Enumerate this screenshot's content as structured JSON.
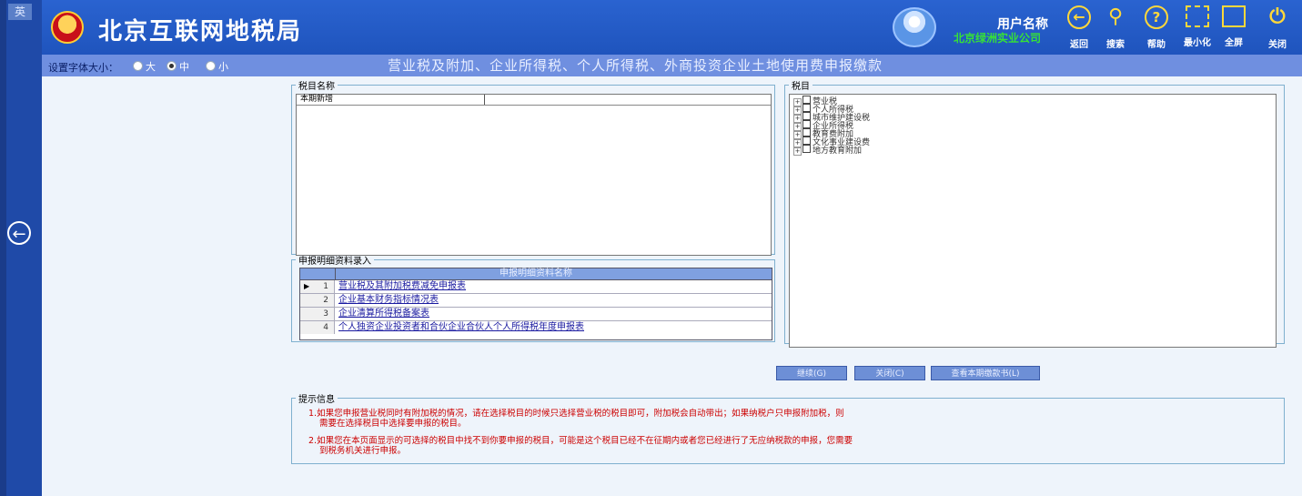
{
  "sidebar": {
    "ying_label": "英"
  },
  "header": {
    "site_title": "北京互联网地税局",
    "user_label": "用户名称",
    "user_company": "北京绿洲实业公司",
    "tools": [
      {
        "label": "返回",
        "icon": "back-circle-icon",
        "glyph": "⊖"
      },
      {
        "label": "搜索",
        "icon": "search-icon",
        "glyph": "Q"
      },
      {
        "label": "帮助",
        "icon": "help-icon",
        "glyph": "?"
      },
      {
        "label": "最小化",
        "icon": "minimize-icon",
        "glyph": "⊏"
      },
      {
        "label": "全屏",
        "icon": "fullscreen-icon",
        "glyph": "□"
      },
      {
        "label": "关闭",
        "icon": "power-icon",
        "glyph": "⏻"
      }
    ]
  },
  "subheader": {
    "font_size_label": "设置字体大小：",
    "font_options": [
      {
        "label": "大",
        "selected": false
      },
      {
        "label": "中",
        "selected": true
      },
      {
        "label": "小",
        "selected": false
      }
    ],
    "page_title": "营业税及附加、企业所得税、个人所得税、外商投资企业土地使用费申报缴款"
  },
  "tax_name_panel": {
    "legend": "税目名称",
    "column_header": "本期新增"
  },
  "detail_panel": {
    "legend": "申报明细资料录入",
    "column_header": "申报明细资料名称",
    "rows": [
      {
        "num": "1",
        "name": "营业税及其附加税费减免申报表",
        "current": true
      },
      {
        "num": "2",
        "name": "企业基本财务指标情况表",
        "current": false
      },
      {
        "num": "3",
        "name": "企业清算所得税备案表",
        "current": false
      },
      {
        "num": "4",
        "name": "个人独资企业投资者和合伙企业合伙人个人所得税年度申报表",
        "current": false
      }
    ]
  },
  "tax_item_panel": {
    "legend": "税目",
    "items": [
      "营业税",
      "个人所得税",
      "城市维护建设税",
      "企业所得税",
      "教育费附加",
      "文化事业建设费",
      "地方教育附加"
    ]
  },
  "buttons": {
    "continue": "继续(G)",
    "close": "关闭(C)",
    "view_payment": "查看本期缴款书(L)"
  },
  "tips": {
    "legend": "提示信息",
    "tip1_line1": "1.如果您申报营业税同时有附加税的情况，请在选择税目的时候只选择营业税的税目即可，附加税会自动带出；如果纳税户只申报附加税，则",
    "tip1_line2": "需要在选择税目中选择要申报的税目。",
    "tip2_line1": "2.如果您在本页面显示的可选择的税目中找不到你要申报的税目，可能是这个税目已经不在征期内或者您已经进行了无应纳税款的申报，您需要",
    "tip2_line2": "到税务机关进行申报。"
  },
  "colors": {
    "header_blue": "#2a63d0",
    "subheader_blue": "#6f8fe0",
    "sidebar_blue": "#1f4aa8",
    "tip_red": "#cc0000",
    "company_green": "#36e038",
    "icon_yellow": "#ffd83a"
  }
}
